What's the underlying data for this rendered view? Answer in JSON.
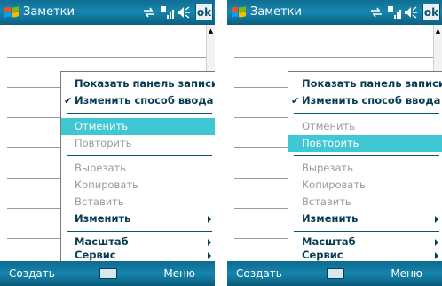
{
  "colors": {
    "titlebar": "#1787b1",
    "highlight": "#3fc7d4",
    "menu_text": "#063b52",
    "disabled_text": "#9a9a9a"
  },
  "screens": [
    {
      "title": "Заметки",
      "ok_label": "ok",
      "icons": [
        "windows-logo-icon",
        "sync-icon",
        "signal-icon",
        "speaker-icon"
      ],
      "menu": {
        "items": [
          {
            "label": "Показать панель записи",
            "checked": false,
            "disabled": false,
            "highlighted": false,
            "submenu": false
          },
          {
            "label": "Изменить способ ввода",
            "checked": true,
            "disabled": false,
            "highlighted": false,
            "submenu": false
          },
          {
            "label": "Отменить",
            "checked": false,
            "disabled": false,
            "highlighted": true,
            "submenu": false
          },
          {
            "label": "Повторить",
            "checked": false,
            "disabled": true,
            "highlighted": false,
            "submenu": false
          },
          {
            "label": "Вырезать",
            "checked": false,
            "disabled": true,
            "highlighted": false,
            "submenu": false
          },
          {
            "label": "Копировать",
            "checked": false,
            "disabled": true,
            "highlighted": false,
            "submenu": false
          },
          {
            "label": "Вставить",
            "checked": false,
            "disabled": true,
            "highlighted": false,
            "submenu": false
          },
          {
            "label": "Изменить",
            "checked": false,
            "disabled": false,
            "highlighted": false,
            "submenu": true
          },
          {
            "label": "Масштаб",
            "checked": false,
            "disabled": false,
            "highlighted": false,
            "submenu": true
          },
          {
            "label": "Сервис",
            "checked": false,
            "disabled": false,
            "highlighted": false,
            "submenu": true
          }
        ]
      },
      "softkeys": {
        "left": "Создать",
        "right": "Меню"
      }
    },
    {
      "title": "Заметки",
      "ok_label": "ok",
      "icons": [
        "windows-logo-icon",
        "sync-icon",
        "signal-icon",
        "speaker-icon"
      ],
      "menu": {
        "items": [
          {
            "label": "Показать панель записи",
            "checked": false,
            "disabled": false,
            "highlighted": false,
            "submenu": false
          },
          {
            "label": "Изменить способ ввода",
            "checked": true,
            "disabled": false,
            "highlighted": false,
            "submenu": false
          },
          {
            "label": "Отменить",
            "checked": false,
            "disabled": true,
            "highlighted": false,
            "submenu": false
          },
          {
            "label": "Повторить",
            "checked": false,
            "disabled": false,
            "highlighted": true,
            "submenu": false
          },
          {
            "label": "Вырезать",
            "checked": false,
            "disabled": true,
            "highlighted": false,
            "submenu": false
          },
          {
            "label": "Копировать",
            "checked": false,
            "disabled": true,
            "highlighted": false,
            "submenu": false
          },
          {
            "label": "Вставить",
            "checked": false,
            "disabled": true,
            "highlighted": false,
            "submenu": false
          },
          {
            "label": "Изменить",
            "checked": false,
            "disabled": false,
            "highlighted": false,
            "submenu": true
          },
          {
            "label": "Масштаб",
            "checked": false,
            "disabled": false,
            "highlighted": false,
            "submenu": true
          },
          {
            "label": "Сервис",
            "checked": false,
            "disabled": false,
            "highlighted": false,
            "submenu": true
          }
        ]
      },
      "softkeys": {
        "left": "Создать",
        "right": "Меню"
      }
    }
  ]
}
